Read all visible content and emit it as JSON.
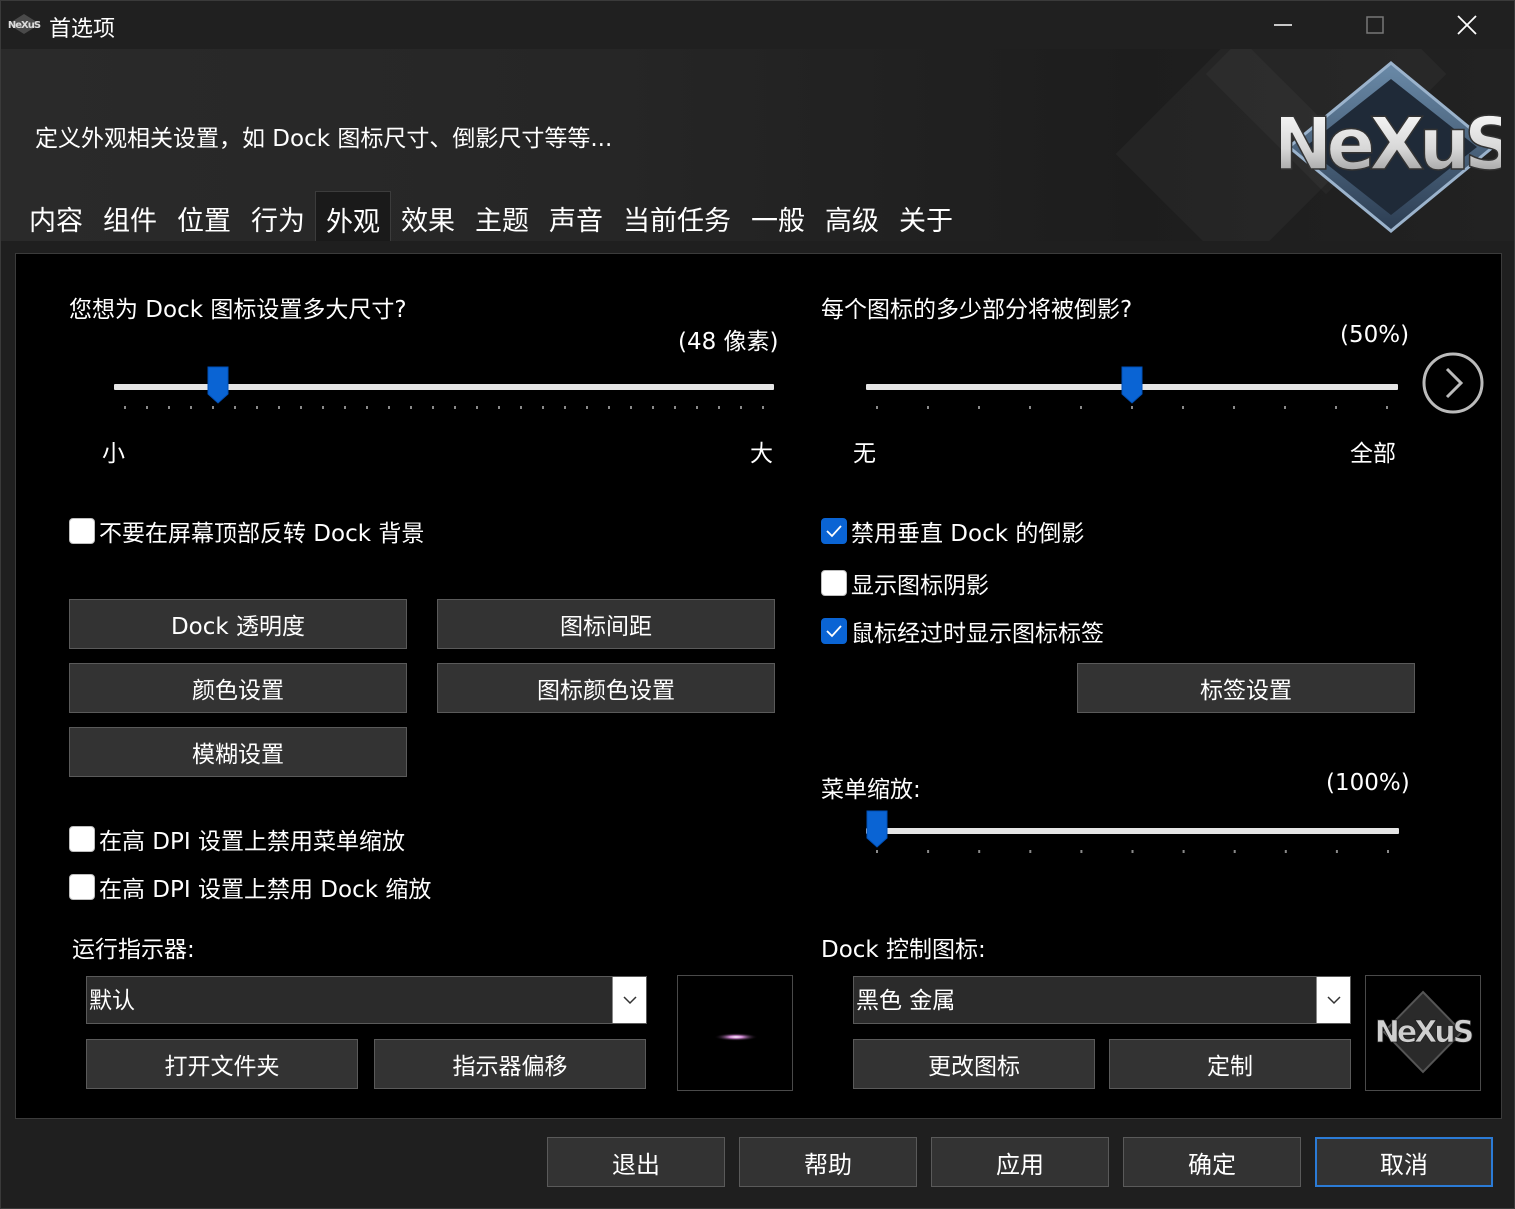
{
  "window": {
    "title": "首选项"
  },
  "header": {
    "description": "定义外观相关设置，如 Dock 图标尺寸、倒影尺寸等等..."
  },
  "tabs": [
    {
      "label": "内容",
      "active": false
    },
    {
      "label": "组件",
      "active": false
    },
    {
      "label": "位置",
      "active": false
    },
    {
      "label": "行为",
      "active": false
    },
    {
      "label": "外观",
      "active": true
    },
    {
      "label": "效果",
      "active": false
    },
    {
      "label": "主题",
      "active": false
    },
    {
      "label": "声音",
      "active": false
    },
    {
      "label": "当前任务",
      "active": false
    },
    {
      "label": "一般",
      "active": false
    },
    {
      "label": "高级",
      "active": false
    },
    {
      "label": "关于",
      "active": false
    }
  ],
  "icon_size": {
    "question": "您想为 Dock 图标设置多大尺寸?",
    "value_text": "(48 像素)",
    "min_label": "小",
    "max_label": "大",
    "fraction": 0.145
  },
  "reflection": {
    "question": "每个图标的多少部分将被倒影?",
    "value_text": "(50%)",
    "min_label": "无",
    "max_label": "全部",
    "fraction": 0.5
  },
  "checkboxes": {
    "no_flip_top": {
      "label": "不要在屏幕顶部反转 Dock 背景",
      "checked": false
    },
    "disable_vertical_reflection": {
      "label": "禁用垂直 Dock 的倒影",
      "checked": true
    },
    "show_icon_shadow": {
      "label": "显示图标阴影",
      "checked": false
    },
    "show_labels_hover": {
      "label": "鼠标经过时显示图标标签",
      "checked": true
    },
    "disable_menu_scaling_dpi": {
      "label": "在高 DPI 设置上禁用菜单缩放",
      "checked": false
    },
    "disable_dock_scaling_dpi": {
      "label": "在高 DPI 设置上禁用 Dock 缩放",
      "checked": false
    }
  },
  "buttons": {
    "dock_opacity": "Dock 透明度",
    "icon_spacing": "图标间距",
    "color_settings": "颜色设置",
    "icon_color_settings": "图标颜色设置",
    "blur_settings": "模糊设置",
    "label_settings": "标签设置",
    "open_folder": "打开文件夹",
    "indicator_offset": "指示器偏移",
    "change_icon": "更改图标",
    "customize": "定制"
  },
  "menu_scale": {
    "label": "菜单缩放:",
    "value_text": "(100%)",
    "fraction": 0.0
  },
  "running_indicator": {
    "label": "运行指示器:",
    "selected": "默认"
  },
  "dock_control_icon": {
    "label": "Dock 控制图标:",
    "selected": "黑色 金属"
  },
  "footer": {
    "exit": "退出",
    "help": "帮助",
    "apply": "应用",
    "ok": "确定",
    "cancel": "取消"
  },
  "colors": {
    "accent": "#0a64d4",
    "focus_border": "#2b7bd6",
    "button_bg": "#333333",
    "panel_bg": "#000000"
  },
  "logo_text": "NeXuS"
}
